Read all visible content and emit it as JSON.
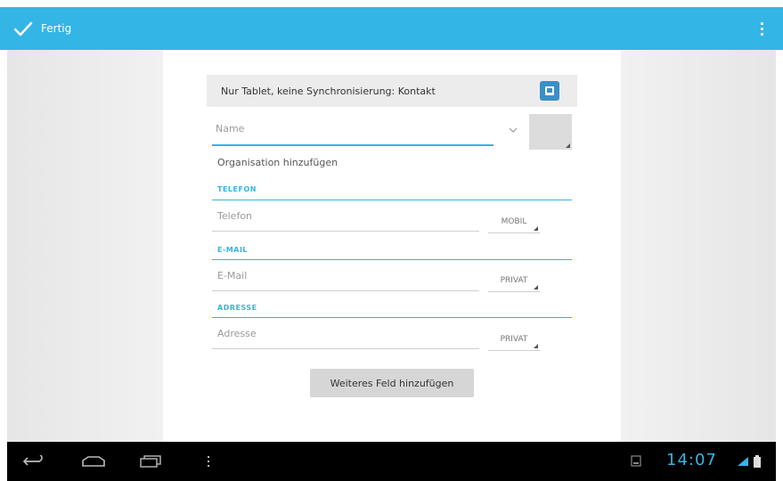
{
  "action_bar": {
    "done_label": "Fertig",
    "accent": "#33b5e5",
    "done_icon": "checkmark-icon",
    "overflow_icon": "overflow-menu-icon"
  },
  "account": {
    "text": "Nur Tablet, keine Synchronisierung: Kontakt",
    "icon": "tablet-account-icon"
  },
  "name": {
    "placeholder": "Name",
    "expand_icon": "chevron-down-icon",
    "photo_icon": "contact-photo-icon"
  },
  "organization": {
    "label": "Organisation hinzufügen"
  },
  "sections": [
    {
      "title": "TELEFON",
      "placeholder": "Telefon",
      "type": "MOBIL"
    },
    {
      "title": "E-MAIL",
      "placeholder": "E-Mail",
      "type": "PRIVAT"
    },
    {
      "title": "ADRESSE",
      "placeholder": "Adresse",
      "type": "PRIVAT"
    }
  ],
  "add_field_button": "Weiteres Feld hinzufügen",
  "nav_bar": {
    "back_icon": "back-icon",
    "home_icon": "home-icon",
    "recents_icon": "recent-apps-icon",
    "menu_icon": "menu-icon"
  },
  "status": {
    "time": "14:07",
    "notification_icon": "screenshot-notification-icon",
    "wifi_icon": "wifi-icon",
    "battery_icon": "battery-icon"
  }
}
